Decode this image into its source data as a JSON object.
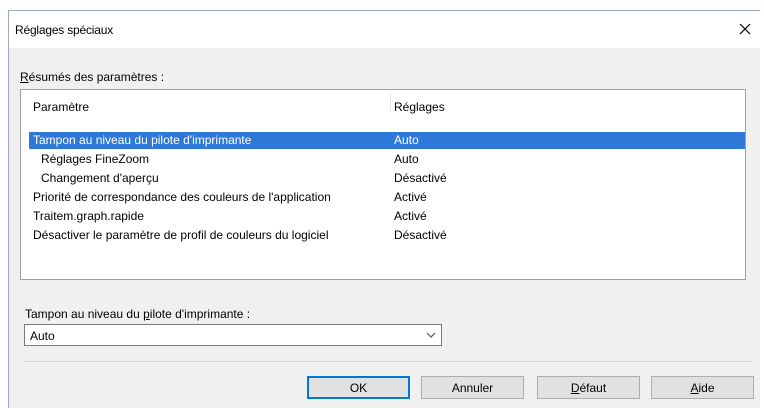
{
  "dialog": {
    "title": "Réglages spéciaux",
    "close_icon": "close-icon"
  },
  "summary": {
    "label_first": "R",
    "label_rest": "ésumés des paramètres :",
    "columns": [
      "Paramètre",
      "Réglages"
    ],
    "rows": [
      {
        "param": "Tampon au niveau du pilote d'imprimante",
        "value": "Auto",
        "selected": true
      },
      {
        "param": "Réglages FineZoom",
        "value": "Auto",
        "indent": true
      },
      {
        "param": "Changement d'aperçu",
        "value": "Désactivé",
        "indent": true
      },
      {
        "param": "Priorité de correspondance des couleurs de l'application",
        "value": "Activé"
      },
      {
        "param": "Traitem.graph.rapide",
        "value": "Activé"
      },
      {
        "param": "Désactiver le paramètre de profil de couleurs du logiciel",
        "value": "Désactivé"
      }
    ]
  },
  "buffer_field": {
    "label_pre": "Tampon au niveau du ",
    "label_ul": "p",
    "label_post": "ilote d'imprimante :",
    "value": "Auto"
  },
  "buttons": {
    "ok": "OK",
    "cancel": "Annuler",
    "default_ul": "D",
    "default_rest": "éfaut",
    "help_ul": "A",
    "help_rest": "ide"
  },
  "colors": {
    "selection": "#2e78d8",
    "default_button_border": "#0078d7"
  }
}
